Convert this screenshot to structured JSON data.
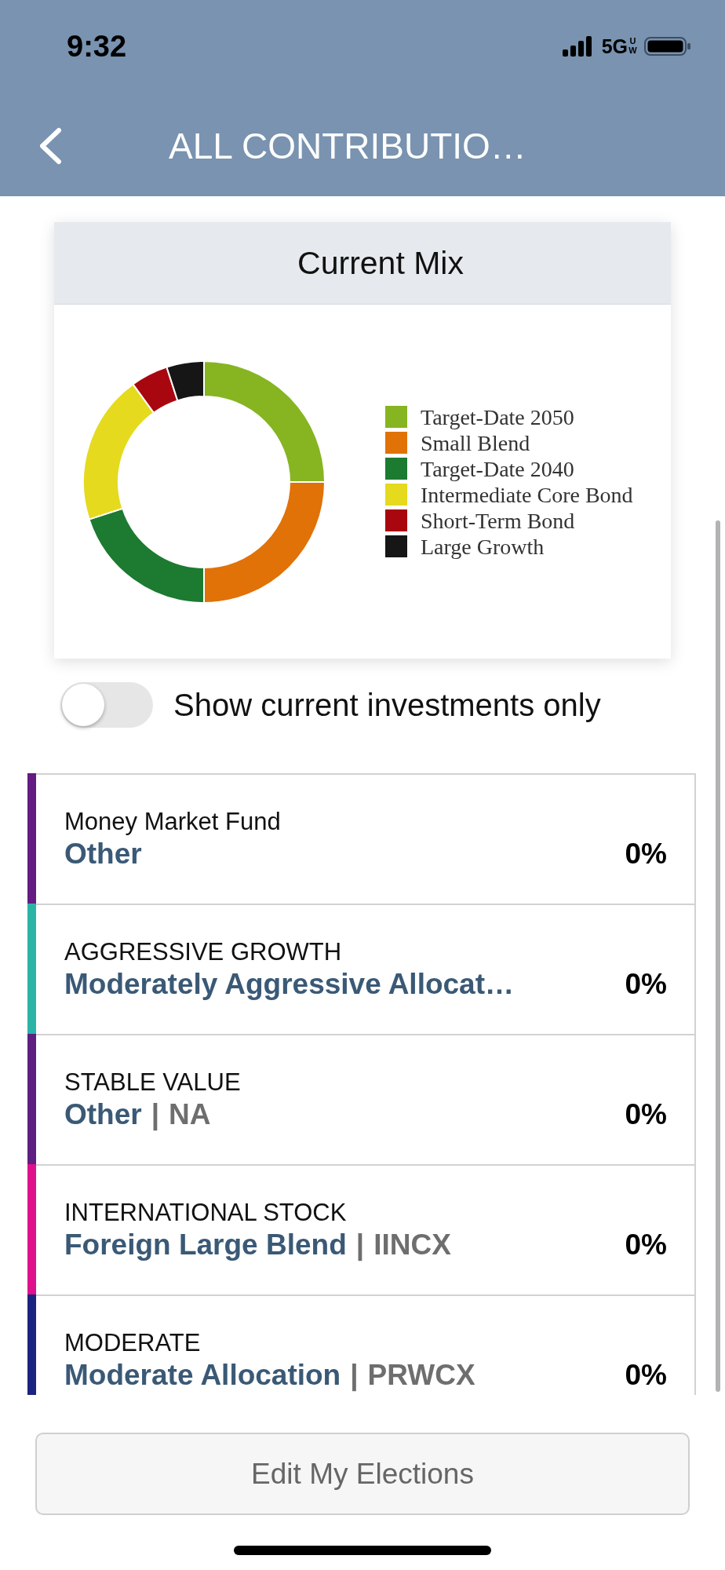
{
  "status_bar": {
    "time": "9:32",
    "network": "5G",
    "network_suffix": "UW"
  },
  "header": {
    "title": "ALL CONTRIBUTIO…"
  },
  "current_mix": {
    "title": "Current Mix",
    "legend": [
      {
        "label": "Target-Date 2050",
        "color": "#86b521"
      },
      {
        "label": "Small Blend",
        "color": "#e07208"
      },
      {
        "label": "Target-Date 2040",
        "color": "#1c7a31"
      },
      {
        "label": "Intermediate Core Bond",
        "color": "#e5da1d"
      },
      {
        "label": "Short-Term Bond",
        "color": "#a8070f"
      },
      {
        "label": "Large Growth",
        "color": "#161616"
      }
    ]
  },
  "toggle": {
    "label": "Show current investments only",
    "on": false
  },
  "funds": [
    {
      "category": "Money Market Fund",
      "name": "Other",
      "percent": "0%",
      "color": "#621c82"
    },
    {
      "category": "AGGRESSIVE GROWTH",
      "name": "Moderately Aggressive Allocat…",
      "percent": "0%",
      "color": "#2bb3a6"
    },
    {
      "category": "STABLE VALUE",
      "name": "Other",
      "separator": "|",
      "ticker": "NA",
      "percent": "0%",
      "color": "#5d1f80"
    },
    {
      "category": "INTERNATIONAL STOCK",
      "name": "Foreign Large Blend",
      "separator": "|",
      "ticker": "IINCX",
      "percent": "0%",
      "color": "#df108b"
    },
    {
      "category": "MODERATE",
      "name": "Moderate Allocation",
      "separator": "|",
      "ticker": "PRWCX",
      "percent": "0%",
      "color": "#1b2380"
    }
  ],
  "edit_button": {
    "label": "Edit My Elections"
  }
}
